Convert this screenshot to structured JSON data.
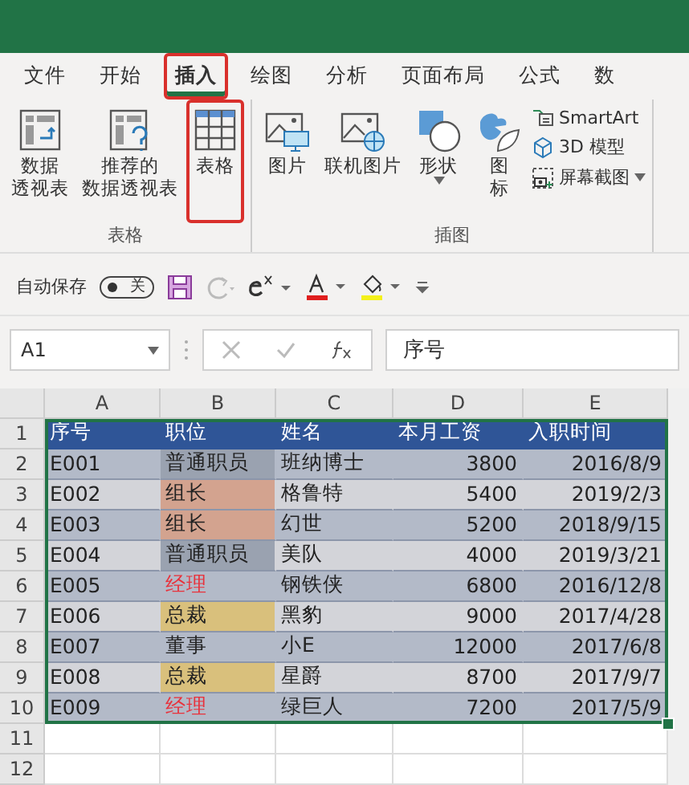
{
  "ribbon_tabs": [
    {
      "label": "文件",
      "selected": false,
      "highlighted": false
    },
    {
      "label": "开始",
      "selected": false,
      "highlighted": false
    },
    {
      "label": "插入",
      "selected": true,
      "highlighted": true
    },
    {
      "label": "绘图",
      "selected": false,
      "highlighted": false
    },
    {
      "label": "分析",
      "selected": false,
      "highlighted": false
    },
    {
      "label": "页面布局",
      "selected": false,
      "highlighted": false
    },
    {
      "label": "公式",
      "selected": false,
      "highlighted": false
    },
    {
      "label": "数",
      "selected": false,
      "highlighted": false
    }
  ],
  "ribbon_groups": [
    {
      "label": "表格",
      "items": [
        {
          "kind": "pivot",
          "lines": [
            "数据",
            "透视表"
          ],
          "highlighted": false
        },
        {
          "kind": "recommended-pivot",
          "lines": [
            "推荐的",
            "数据透视表"
          ],
          "highlighted": false
        },
        {
          "kind": "table",
          "lines": [
            "表格"
          ],
          "highlighted": true
        }
      ]
    },
    {
      "label": "插图",
      "items": [
        {
          "kind": "picture",
          "lines": [
            "图片"
          ],
          "highlighted": false
        },
        {
          "kind": "online-picture",
          "lines": [
            "联机图片"
          ],
          "highlighted": false
        },
        {
          "kind": "shapes",
          "lines": [
            "形状"
          ],
          "highlighted": false,
          "dropdown": true
        },
        {
          "kind": "icons",
          "lines": [
            "图",
            "标"
          ],
          "highlighted": false
        }
      ],
      "small_items": [
        {
          "kind": "smartart",
          "label": "SmartArt"
        },
        {
          "kind": "model",
          "label": "3D 模型"
        },
        {
          "kind": "screenshot",
          "label": "屏幕截图",
          "dropdown": true
        }
      ]
    }
  ],
  "quick_access": {
    "autosave_label": "自动保存",
    "autosave": {
      "on": false,
      "label": "关"
    }
  },
  "formula_bar": {
    "name_box": "A1",
    "value": "序号"
  },
  "sheet": {
    "columns": [
      "A",
      "B",
      "C",
      "D",
      "E"
    ],
    "row_numbers": [
      "1",
      "2",
      "3",
      "4",
      "5",
      "6",
      "7",
      "8",
      "9",
      "10",
      "11",
      "12"
    ],
    "header": [
      "序号",
      "职位",
      "姓名",
      "本月工资",
      "入职时间"
    ],
    "rows": [
      {
        "id": "E001",
        "position": {
          "text": "普通职员",
          "color": "#9aa2b0"
        },
        "name": "班纳博士",
        "salary": "3800",
        "date": "2016/8/9"
      },
      {
        "id": "E002",
        "position": {
          "text": "组长",
          "color": "#d3a38f"
        },
        "name": "格鲁特",
        "salary": "5400",
        "date": "2019/2/3"
      },
      {
        "id": "E003",
        "position": {
          "text": "组长",
          "color": "#d3a38f"
        },
        "name": "幻世",
        "salary": "5200",
        "date": "2018/9/15"
      },
      {
        "id": "E004",
        "position": {
          "text": "普通职员",
          "color": "#9aa2b0"
        },
        "name": "美队",
        "salary": "4000",
        "date": "2019/3/21"
      },
      {
        "id": "E005",
        "position": {
          "text": "经理",
          "alert": true
        },
        "name": "钢铁侠",
        "salary": "6800",
        "date": "2016/12/8"
      },
      {
        "id": "E006",
        "position": {
          "text": "总裁",
          "color": "#d9c07c"
        },
        "name": "黑豹",
        "salary": "9000",
        "date": "2017/4/28"
      },
      {
        "id": "E007",
        "position": {
          "text": "董事"
        },
        "name": "小E",
        "salary": "12000",
        "date": "2017/6/8"
      },
      {
        "id": "E008",
        "position": {
          "text": "总裁",
          "color": "#d9c07c"
        },
        "name": "星爵",
        "salary": "8700",
        "date": "2017/9/7"
      },
      {
        "id": "E009",
        "position": {
          "text": "经理",
          "alert": true
        },
        "name": "绿巨人",
        "salary": "7200",
        "date": "2017/5/9"
      }
    ]
  }
}
